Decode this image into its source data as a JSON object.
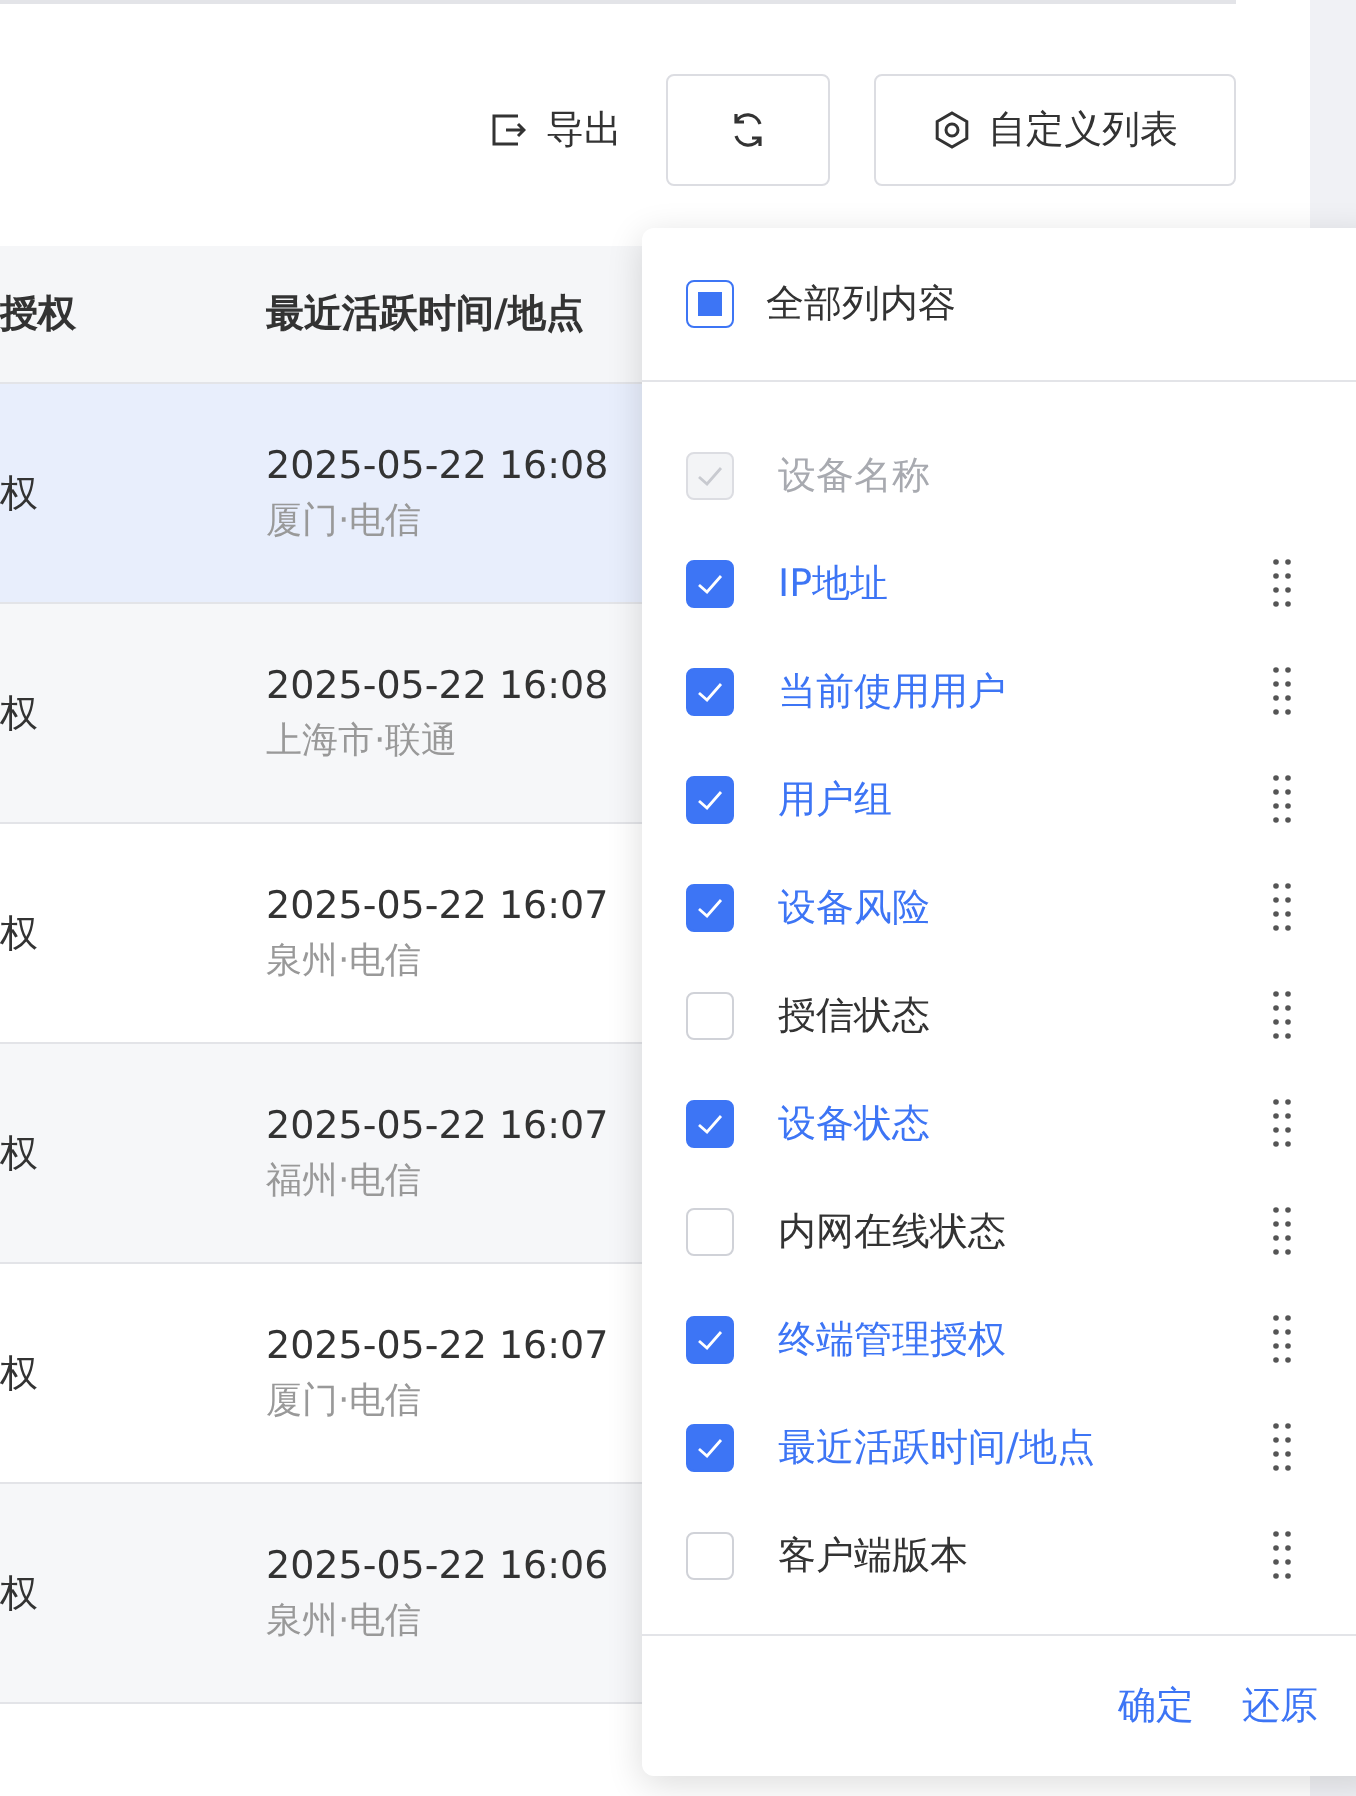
{
  "toolbar": {
    "export_label": "导出",
    "customize_label": "自定义列表"
  },
  "table": {
    "columns": [
      "授权",
      "最近活跃时间/地点"
    ],
    "rows": [
      {
        "column_1": "权",
        "time": "2025-05-22 16:08",
        "location": "厦门·电信",
        "selected": true
      },
      {
        "column_1": "权",
        "time": "2025-05-22 16:08",
        "location": "上海市·联通",
        "selected": false
      },
      {
        "column_1": "权",
        "time": "2025-05-22 16:07",
        "location": "泉州·电信",
        "selected": false
      },
      {
        "column_1": "权",
        "time": "2025-05-22 16:07",
        "location": "福州·电信",
        "selected": false
      },
      {
        "column_1": "权",
        "time": "2025-05-22 16:07",
        "location": "厦门·电信",
        "selected": false
      },
      {
        "column_1": "权",
        "time": "2025-05-22 16:06",
        "location": "泉州·电信",
        "selected": false
      }
    ]
  },
  "column_picker": {
    "all_label": "全部列内容",
    "all_checked": false,
    "all_indeterminate": true,
    "items": [
      {
        "label": "设备名称",
        "checked": true,
        "disabled": true
      },
      {
        "label": "IP地址",
        "checked": true,
        "disabled": false
      },
      {
        "label": "当前使用用户",
        "checked": true,
        "disabled": false
      },
      {
        "label": "用户组",
        "checked": true,
        "disabled": false
      },
      {
        "label": "设备风险",
        "checked": true,
        "disabled": false
      },
      {
        "label": "授信状态",
        "checked": false,
        "disabled": false
      },
      {
        "label": "设备状态",
        "checked": true,
        "disabled": false
      },
      {
        "label": "内网在线状态",
        "checked": false,
        "disabled": false
      },
      {
        "label": "终端管理授权",
        "checked": true,
        "disabled": false
      },
      {
        "label": "最近活跃时间/地点",
        "checked": true,
        "disabled": false
      },
      {
        "label": "客户端版本",
        "checked": false,
        "disabled": false
      }
    ],
    "buttons": [
      "确定",
      "还原"
    ]
  }
}
